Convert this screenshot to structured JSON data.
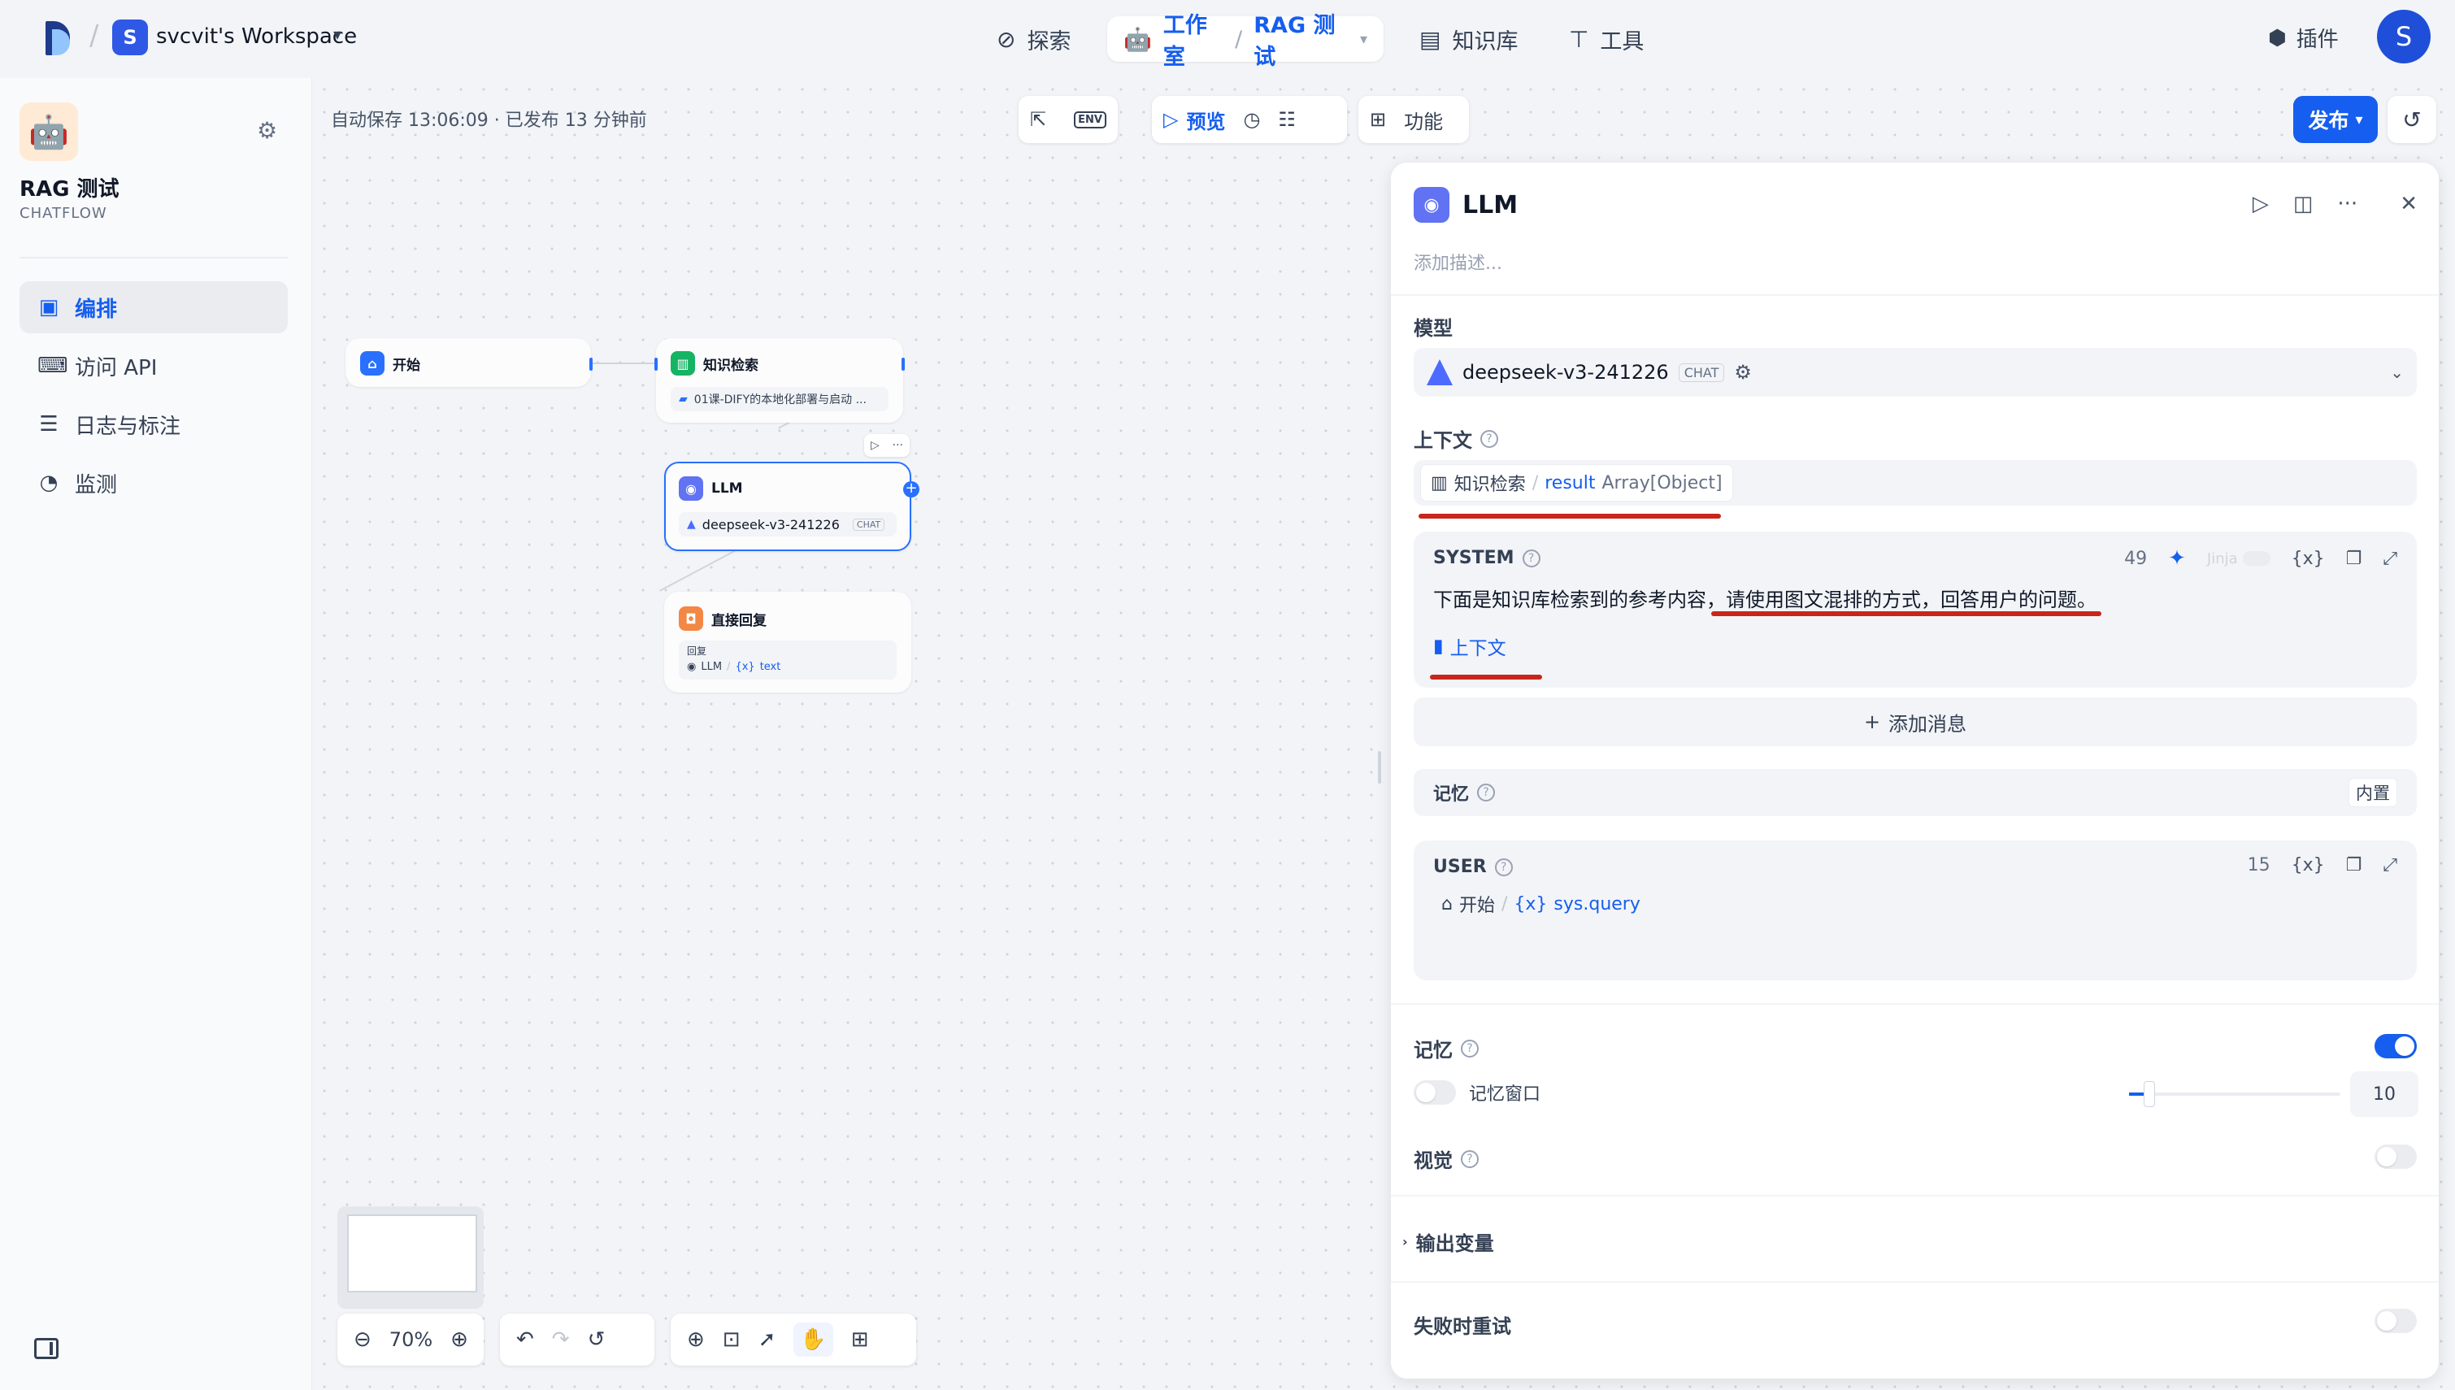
{
  "topbar": {
    "workspace_initial": "S",
    "workspace_name": "svcvit's Workspace",
    "nav": {
      "explore": "探索",
      "studio": "工作室",
      "app": "RAG 测试",
      "knowledge": "知识库",
      "tools": "工具"
    },
    "plugins": "插件",
    "user_initial": "S"
  },
  "sidebar": {
    "app_name": "RAG 测试",
    "app_type": "CHATFLOW",
    "items": [
      {
        "label": "编排",
        "icon": "layout-icon"
      },
      {
        "label": "访问 API",
        "icon": "terminal-icon"
      },
      {
        "label": "日志与标注",
        "icon": "file-list-icon"
      },
      {
        "label": "监测",
        "icon": "gauge-icon"
      }
    ]
  },
  "canvas": {
    "autosave": "自动保存 13:06:09 · 已发布 13 分钟前",
    "toolbar": {
      "env": "ENV",
      "preview": "预览",
      "features": "功能",
      "publish": "发布"
    },
    "zoom": "70%",
    "nodes": {
      "start": {
        "title": "开始"
      },
      "kr": {
        "title": "知识检索",
        "dataset": "01课-DIFY的本地化部署与启动 ..."
      },
      "llm": {
        "title": "LLM",
        "model": "deepseek-v3-241226",
        "tag": "CHAT"
      },
      "answer": {
        "title": "直接回复",
        "label": "回复",
        "ref_node": "LLM",
        "ref_var": "text"
      }
    }
  },
  "panel": {
    "title": "LLM",
    "description_placeholder": "添加描述...",
    "model_label": "模型",
    "model_name": "deepseek-v3-241226",
    "model_tag": "CHAT",
    "context_label": "上下文",
    "context_node": "知识检索",
    "context_var": "result",
    "context_type": "Array[Object]",
    "system": {
      "role": "SYSTEM",
      "count": "49",
      "jinja": "Jinja",
      "var_btn": "{x}",
      "text_a": "下面是知识库检索到的参考内容，",
      "text_b": "请使用图文混排的方式，回答用户的问题。",
      "context_chip": "上下文"
    },
    "add_message": "添加消息",
    "memory_row_label": "记忆",
    "memory_builtin": "内置",
    "user": {
      "role": "USER",
      "count": "15",
      "var_btn": "{x}",
      "node": "开始",
      "var": "sys.query"
    },
    "memory_label": "记忆",
    "memory_enabled": true,
    "memory_window_label": "记忆窗口",
    "memory_window_value": "10",
    "vision_label": "视觉",
    "output_label": "输出变量",
    "retry_label": "失败时重试"
  }
}
